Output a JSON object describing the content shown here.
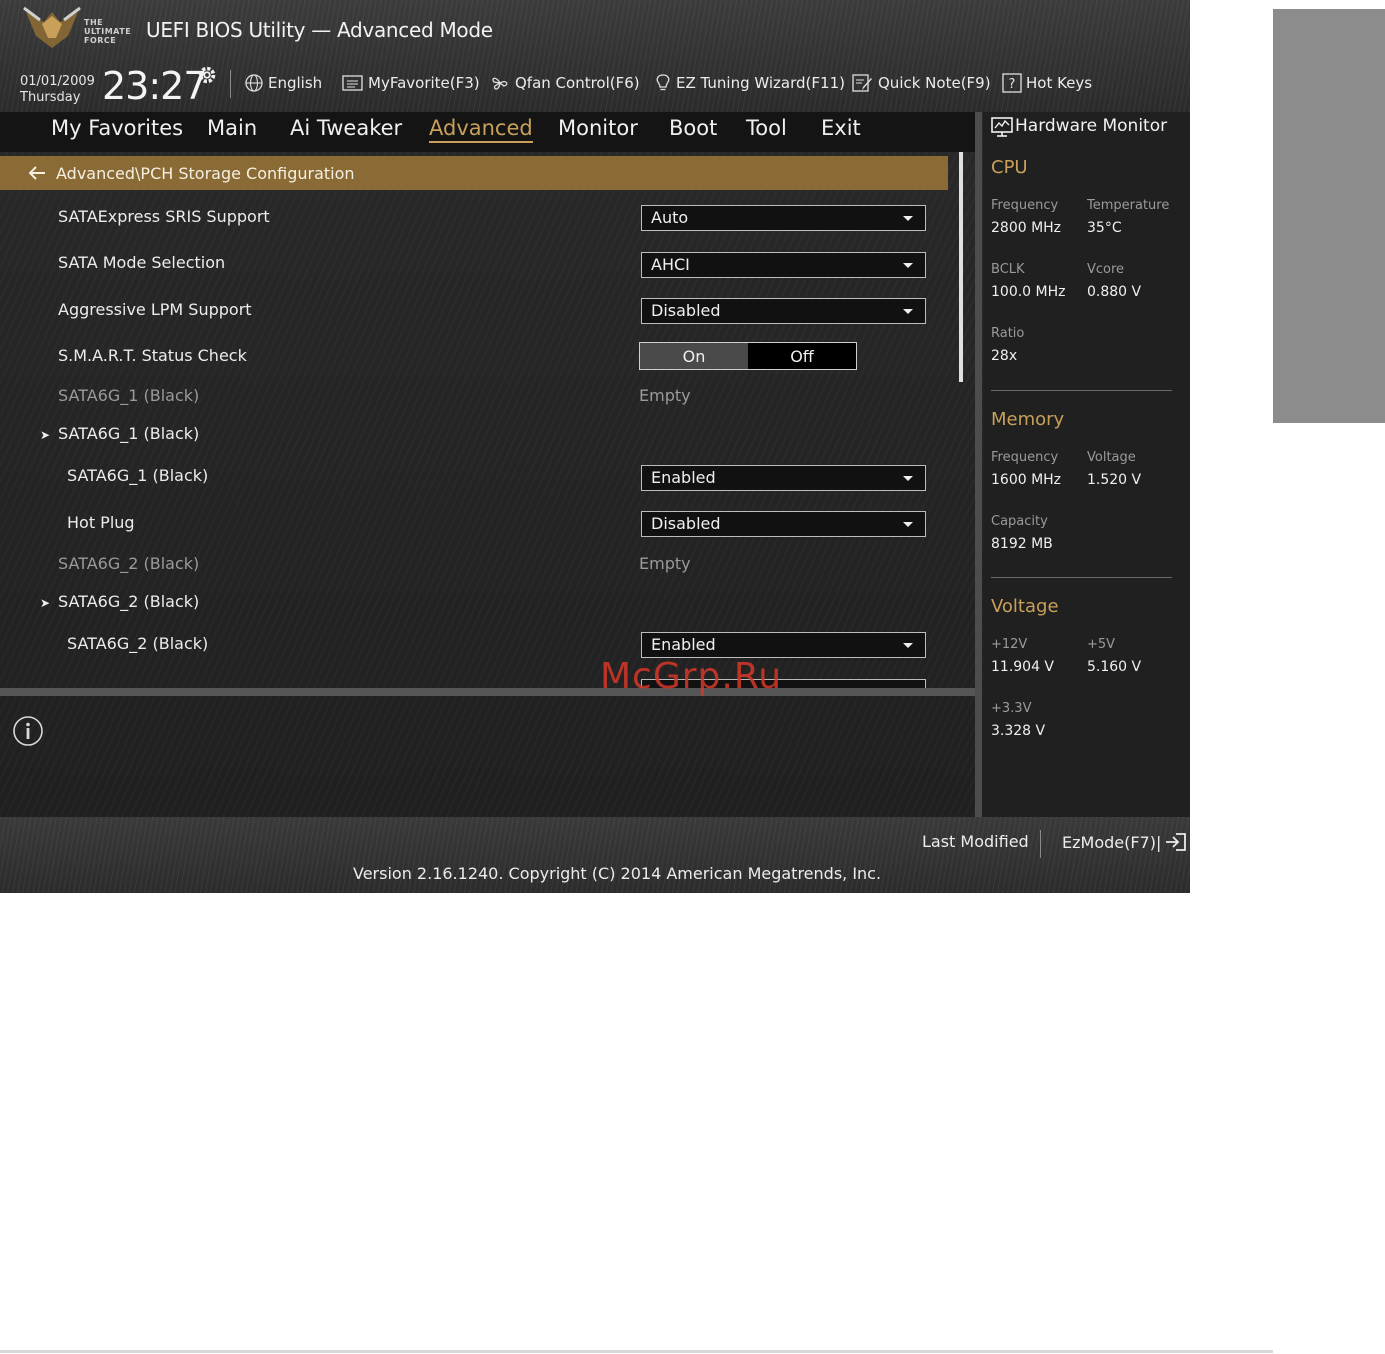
{
  "header": {
    "title": "UEFI BIOS Utility — Advanced Mode",
    "logo_text": [
      "THE",
      "ULTIMATE",
      "FORCE"
    ],
    "date": "01/01/2009",
    "day": "Thursday",
    "time": "23:27"
  },
  "toolbar": [
    {
      "icon": "globe-icon",
      "label": "English"
    },
    {
      "icon": "favorite-list-icon",
      "label": "MyFavorite(F3)"
    },
    {
      "icon": "fan-icon",
      "label": "Qfan Control(F6)"
    },
    {
      "icon": "lightbulb-icon",
      "label": "EZ Tuning Wizard(F11)"
    },
    {
      "icon": "note-pencil-icon",
      "label": "Quick Note(F9)"
    },
    {
      "icon": "help-box-icon",
      "label": "Hot Keys"
    }
  ],
  "menu": {
    "items": [
      "My Favorites",
      "Main",
      "Ai Tweaker",
      "Advanced",
      "Monitor",
      "Boot",
      "Tool",
      "Exit"
    ],
    "active": "Advanced"
  },
  "breadcrumb": "Advanced\\PCH Storage Configuration",
  "settings": [
    {
      "label": "SATAExpress SRIS Support",
      "value": "Auto"
    },
    {
      "label": "SATA Mode Selection",
      "value": "AHCI"
    },
    {
      "label": "Aggressive LPM Support",
      "value": "Disabled"
    },
    {
      "label": "S.M.A.R.T. Status Check",
      "on": "On",
      "off": "Off",
      "selected": "On"
    },
    {
      "label": "SATA6G_1 (Black)",
      "value": "Empty"
    },
    {
      "label": "SATA6G_1 (Black)"
    },
    {
      "label": "SATA6G_1 (Black)",
      "value": "Enabled"
    },
    {
      "label": "Hot Plug",
      "value": "Disabled"
    },
    {
      "label": "SATA6G_2 (Black)",
      "value": "Empty"
    },
    {
      "label": "SATA6G_2 (Black)"
    },
    {
      "label": "SATA6G_2 (Black)",
      "value": "Enabled"
    }
  ],
  "hw_monitor": {
    "title": "Hardware Monitor",
    "cpu": {
      "heading": "CPU",
      "frequency_label": "Frequency",
      "frequency": "2800 MHz",
      "temperature_label": "Temperature",
      "temperature": "35°C",
      "bclk_label": "BCLK",
      "bclk": "100.0 MHz",
      "vcore_label": "Vcore",
      "vcore": "0.880 V",
      "ratio_label": "Ratio",
      "ratio": "28x"
    },
    "memory": {
      "heading": "Memory",
      "frequency_label": "Frequency",
      "frequency": "1600 MHz",
      "voltage_label": "Voltage",
      "voltage": "1.520 V",
      "capacity_label": "Capacity",
      "capacity": "8192 MB"
    },
    "voltage": {
      "heading": "Voltage",
      "v12_label": "+12V",
      "v12": "11.904 V",
      "v5_label": "+5V",
      "v5": "5.160 V",
      "v33_label": "+3.3V",
      "v33": "3.328 V"
    }
  },
  "footer": {
    "last_modified": "Last Modified",
    "ezmode": "EzMode(F7)|",
    "version": "Version 2.16.1240. Copyright (C) 2014 American Megatrends, Inc."
  },
  "watermark": "McGrp.Ru",
  "colors": {
    "accent": "#c8a05a",
    "breadcrumb_bg": "#8a6a35",
    "watermark": "#d73728"
  }
}
